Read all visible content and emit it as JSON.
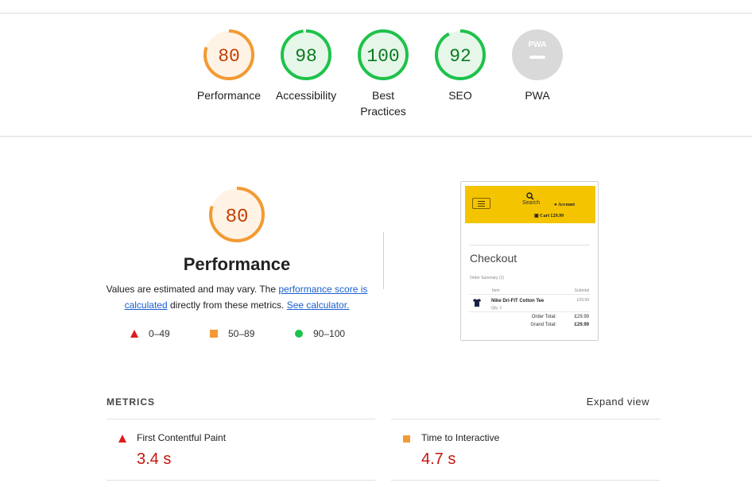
{
  "gauges": [
    {
      "score": "80",
      "label": "Performance",
      "status": "average",
      "color": "#e67700",
      "fill": "#fff3e5",
      "ring": "#f29a33",
      "fraction": 0.8
    },
    {
      "score": "98",
      "label": "Accessibility",
      "status": "pass",
      "color": "#0b7a1f",
      "fill": "#e6f7ea",
      "ring": "#1ec24a",
      "fraction": 0.98
    },
    {
      "score": "100",
      "label": "Best Practices",
      "status": "pass",
      "color": "#0b7a1f",
      "fill": "#e6f7ea",
      "ring": "#1ec24a",
      "fraction": 1.0
    },
    {
      "score": "92",
      "label": "SEO",
      "status": "pass",
      "color": "#0b7a1f",
      "fill": "#e6f7ea",
      "ring": "#1ec24a",
      "fraction": 0.92
    },
    {
      "score": "",
      "label": "PWA",
      "status": "na",
      "badge": "PWA",
      "color": "#ffffff",
      "fill": "#d9d9d9",
      "ring": "#d9d9d9",
      "fraction": 0
    }
  ],
  "performance": {
    "score": "80",
    "fraction": 0.8,
    "title": "Performance",
    "desc_prefix": "Values are estimated and may vary. The ",
    "link_score": "performance score is calculated",
    "desc_middle": " directly from these metrics. ",
    "link_calc": "See calculator."
  },
  "legend": [
    {
      "range": "0–49",
      "shape": "triangle-icon",
      "color": "#e01a1a"
    },
    {
      "range": "50–89",
      "shape": "square-icon",
      "color": "#f29a33"
    },
    {
      "range": "90–100",
      "shape": "circle-icon",
      "color": "#1ec24a"
    }
  ],
  "thumbnail": {
    "search": "Search",
    "account": "Account",
    "cart": "Cart £29.99",
    "checkout": "Checkout",
    "order_summary": "Order Summary (1)",
    "item_header": "Item",
    "subtotal_header": "Subtotal",
    "item_name": "Nike Dri-FIT Cotton Tee",
    "qty": "Qty: 1",
    "item_price": "£29.99",
    "order_total_label": "Order Total:",
    "order_total": "£29.99",
    "grand_total_label": "Grand Total:",
    "grand_total": "£29.99",
    "header_color": "#f5c400"
  },
  "metrics": {
    "header": "METRICS",
    "expand_label": "Expand view",
    "items": [
      {
        "name": "First Contentful Paint",
        "value": "3.4 s",
        "status": "fail",
        "color": "#c4160f"
      },
      {
        "name": "Time to Interactive",
        "value": "4.7 s",
        "status": "average",
        "color": "#c4160f"
      }
    ]
  }
}
